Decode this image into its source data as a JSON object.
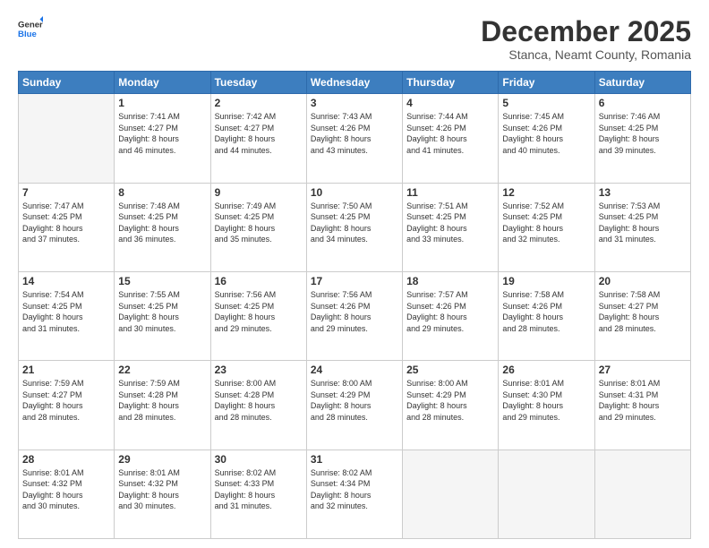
{
  "header": {
    "logo_general": "General",
    "logo_blue": "Blue",
    "month_title": "December 2025",
    "location": "Stanca, Neamt County, Romania"
  },
  "days_of_week": [
    "Sunday",
    "Monday",
    "Tuesday",
    "Wednesday",
    "Thursday",
    "Friday",
    "Saturday"
  ],
  "weeks": [
    [
      {
        "day": "",
        "info": ""
      },
      {
        "day": "1",
        "info": "Sunrise: 7:41 AM\nSunset: 4:27 PM\nDaylight: 8 hours\nand 46 minutes."
      },
      {
        "day": "2",
        "info": "Sunrise: 7:42 AM\nSunset: 4:27 PM\nDaylight: 8 hours\nand 44 minutes."
      },
      {
        "day": "3",
        "info": "Sunrise: 7:43 AM\nSunset: 4:26 PM\nDaylight: 8 hours\nand 43 minutes."
      },
      {
        "day": "4",
        "info": "Sunrise: 7:44 AM\nSunset: 4:26 PM\nDaylight: 8 hours\nand 41 minutes."
      },
      {
        "day": "5",
        "info": "Sunrise: 7:45 AM\nSunset: 4:26 PM\nDaylight: 8 hours\nand 40 minutes."
      },
      {
        "day": "6",
        "info": "Sunrise: 7:46 AM\nSunset: 4:25 PM\nDaylight: 8 hours\nand 39 minutes."
      }
    ],
    [
      {
        "day": "7",
        "info": "Sunrise: 7:47 AM\nSunset: 4:25 PM\nDaylight: 8 hours\nand 37 minutes."
      },
      {
        "day": "8",
        "info": "Sunrise: 7:48 AM\nSunset: 4:25 PM\nDaylight: 8 hours\nand 36 minutes."
      },
      {
        "day": "9",
        "info": "Sunrise: 7:49 AM\nSunset: 4:25 PM\nDaylight: 8 hours\nand 35 minutes."
      },
      {
        "day": "10",
        "info": "Sunrise: 7:50 AM\nSunset: 4:25 PM\nDaylight: 8 hours\nand 34 minutes."
      },
      {
        "day": "11",
        "info": "Sunrise: 7:51 AM\nSunset: 4:25 PM\nDaylight: 8 hours\nand 33 minutes."
      },
      {
        "day": "12",
        "info": "Sunrise: 7:52 AM\nSunset: 4:25 PM\nDaylight: 8 hours\nand 32 minutes."
      },
      {
        "day": "13",
        "info": "Sunrise: 7:53 AM\nSunset: 4:25 PM\nDaylight: 8 hours\nand 31 minutes."
      }
    ],
    [
      {
        "day": "14",
        "info": "Sunrise: 7:54 AM\nSunset: 4:25 PM\nDaylight: 8 hours\nand 31 minutes."
      },
      {
        "day": "15",
        "info": "Sunrise: 7:55 AM\nSunset: 4:25 PM\nDaylight: 8 hours\nand 30 minutes."
      },
      {
        "day": "16",
        "info": "Sunrise: 7:56 AM\nSunset: 4:25 PM\nDaylight: 8 hours\nand 29 minutes."
      },
      {
        "day": "17",
        "info": "Sunrise: 7:56 AM\nSunset: 4:26 PM\nDaylight: 8 hours\nand 29 minutes."
      },
      {
        "day": "18",
        "info": "Sunrise: 7:57 AM\nSunset: 4:26 PM\nDaylight: 8 hours\nand 29 minutes."
      },
      {
        "day": "19",
        "info": "Sunrise: 7:58 AM\nSunset: 4:26 PM\nDaylight: 8 hours\nand 28 minutes."
      },
      {
        "day": "20",
        "info": "Sunrise: 7:58 AM\nSunset: 4:27 PM\nDaylight: 8 hours\nand 28 minutes."
      }
    ],
    [
      {
        "day": "21",
        "info": "Sunrise: 7:59 AM\nSunset: 4:27 PM\nDaylight: 8 hours\nand 28 minutes."
      },
      {
        "day": "22",
        "info": "Sunrise: 7:59 AM\nSunset: 4:28 PM\nDaylight: 8 hours\nand 28 minutes."
      },
      {
        "day": "23",
        "info": "Sunrise: 8:00 AM\nSunset: 4:28 PM\nDaylight: 8 hours\nand 28 minutes."
      },
      {
        "day": "24",
        "info": "Sunrise: 8:00 AM\nSunset: 4:29 PM\nDaylight: 8 hours\nand 28 minutes."
      },
      {
        "day": "25",
        "info": "Sunrise: 8:00 AM\nSunset: 4:29 PM\nDaylight: 8 hours\nand 28 minutes."
      },
      {
        "day": "26",
        "info": "Sunrise: 8:01 AM\nSunset: 4:30 PM\nDaylight: 8 hours\nand 29 minutes."
      },
      {
        "day": "27",
        "info": "Sunrise: 8:01 AM\nSunset: 4:31 PM\nDaylight: 8 hours\nand 29 minutes."
      }
    ],
    [
      {
        "day": "28",
        "info": "Sunrise: 8:01 AM\nSunset: 4:32 PM\nDaylight: 8 hours\nand 30 minutes."
      },
      {
        "day": "29",
        "info": "Sunrise: 8:01 AM\nSunset: 4:32 PM\nDaylight: 8 hours\nand 30 minutes."
      },
      {
        "day": "30",
        "info": "Sunrise: 8:02 AM\nSunset: 4:33 PM\nDaylight: 8 hours\nand 31 minutes."
      },
      {
        "day": "31",
        "info": "Sunrise: 8:02 AM\nSunset: 4:34 PM\nDaylight: 8 hours\nand 32 minutes."
      },
      {
        "day": "",
        "info": ""
      },
      {
        "day": "",
        "info": ""
      },
      {
        "day": "",
        "info": ""
      }
    ]
  ]
}
